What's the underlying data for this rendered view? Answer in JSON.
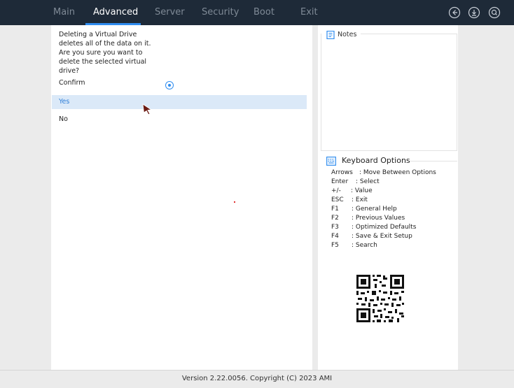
{
  "nav": {
    "tabs": [
      {
        "label": "Main"
      },
      {
        "label": "Advanced"
      },
      {
        "label": "Server"
      },
      {
        "label": "Security"
      },
      {
        "label": "Boot"
      },
      {
        "label": "Exit"
      }
    ],
    "active_tab": "Advanced",
    "icons": [
      "back-icon",
      "download-icon",
      "search-icon"
    ]
  },
  "dialog": {
    "prompt": "Deleting a Virtual Drive deletes all of the data on it. Are you sure you want to delete the selected virtual drive?",
    "confirm_label": "Confirm",
    "confirm_checked": true,
    "options": [
      {
        "label": "Yes",
        "selected": true
      },
      {
        "label": "No",
        "selected": false
      }
    ]
  },
  "notes": {
    "title": "Notes"
  },
  "keyboard": {
    "title": "Keyboard Options",
    "rows": [
      {
        "key": "Arrows",
        "desc": ": Move Between Options"
      },
      {
        "key": "Enter",
        "desc": ": Select"
      },
      {
        "key": "+/-",
        "desc": ": Value"
      },
      {
        "key": "ESC",
        "desc": ": Exit"
      },
      {
        "key": "F1",
        "desc": ": General Help"
      },
      {
        "key": "F2",
        "desc": ": Previous Values"
      },
      {
        "key": "F3",
        "desc": ": Optimized Defaults"
      },
      {
        "key": "F4",
        "desc": ": Save & Exit Setup"
      },
      {
        "key": "F5",
        "desc": ": Search"
      }
    ]
  },
  "footer": {
    "version": "Version 2.22.0056. Copyright (C) 2023 AMI"
  },
  "colors": {
    "topbar": "#1e2a38",
    "accent": "#2f8df0",
    "selection": "#dbe9f8"
  }
}
